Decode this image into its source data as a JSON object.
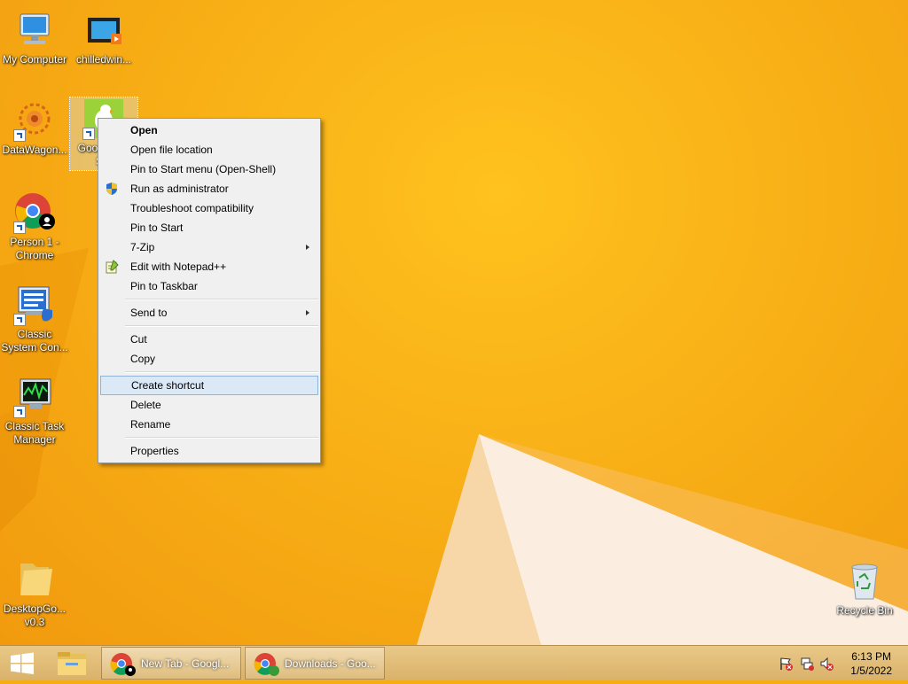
{
  "desktop": {
    "icons": [
      {
        "label": "My Computer"
      },
      {
        "label": "chilledwin..."
      },
      {
        "label": "DataWagon..."
      },
      {
        "label": "Goos... p... S..."
      },
      {
        "label": "Person 1 - Chrome"
      },
      {
        "label": "Classic System Con..."
      },
      {
        "label": "Classic Task Manager"
      },
      {
        "label": "DesktopGo... v0.3"
      },
      {
        "label": "Recycle Bin"
      }
    ]
  },
  "context_menu": {
    "items": [
      {
        "label": "Open",
        "bold": true
      },
      {
        "label": "Open file location"
      },
      {
        "label": "Pin to Start menu (Open-Shell)"
      },
      {
        "label": "Run as administrator",
        "icon": "uac-shield-icon"
      },
      {
        "label": "Troubleshoot compatibility"
      },
      {
        "label": "Pin to Start"
      },
      {
        "label": "7-Zip",
        "submenu": true
      },
      {
        "label": "Edit with Notepad++",
        "icon": "notepadpp-icon"
      },
      {
        "label": "Pin to Taskbar"
      },
      {
        "label": "Send to",
        "submenu": true
      },
      {
        "label": "Cut"
      },
      {
        "label": "Copy"
      },
      {
        "label": "Create shortcut",
        "highlighted": true
      },
      {
        "label": "Delete"
      },
      {
        "label": "Rename"
      },
      {
        "label": "Properties"
      }
    ]
  },
  "taskbar": {
    "tasks": [
      {
        "label": "New Tab - Googl..."
      },
      {
        "label": "Downloads - Goo..."
      }
    ],
    "clock": {
      "time": "6:13 PM",
      "date": "1/5/2022"
    }
  },
  "colors": {
    "wallpaper": "#f6ad14",
    "menu_highlight": "#dbe9f7"
  }
}
